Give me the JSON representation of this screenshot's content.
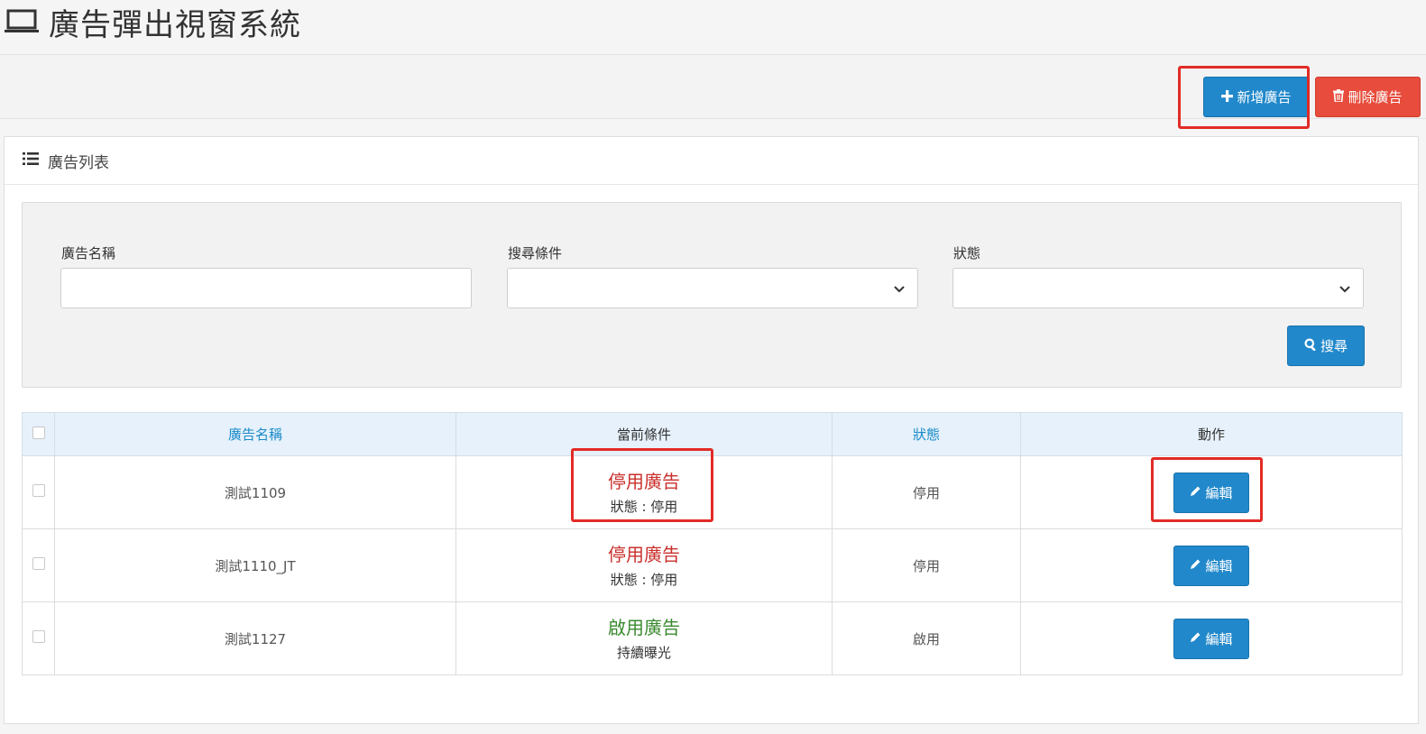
{
  "page": {
    "title": "廣告彈出視窗系統"
  },
  "toolbar": {
    "add_label": "新增廣告",
    "delete_label": "刪除廣告"
  },
  "panel": {
    "title": "廣告列表"
  },
  "filters": {
    "name_label": "廣告名稱",
    "name_value": "",
    "condition_label": "搜尋條件",
    "condition_value": "",
    "status_label": "狀態",
    "status_value": "",
    "search_label": "搜尋"
  },
  "table": {
    "headers": {
      "name": "廣告名稱",
      "condition": "當前條件",
      "status": "狀態",
      "action": "動作"
    },
    "rows": [
      {
        "name": "測試1109",
        "condition": "停用廣告",
        "condition_detail": "狀態 : 停用",
        "status": "停用",
        "action": "編輯"
      },
      {
        "name": "測試1110_JT",
        "condition": "停用廣告",
        "condition_detail": "狀態 : 停用",
        "status": "停用",
        "action": "編輯"
      },
      {
        "name": "測試1127",
        "condition": "啟用廣告",
        "condition_detail": "持續曝光",
        "status": "啟用",
        "action": "編輯"
      }
    ]
  },
  "colors": {
    "primary": "#2188cb",
    "danger": "#e74c3c",
    "highlight": "#e22b26",
    "inactive_text": "#c9302c",
    "active_text": "#3a8a2f"
  }
}
